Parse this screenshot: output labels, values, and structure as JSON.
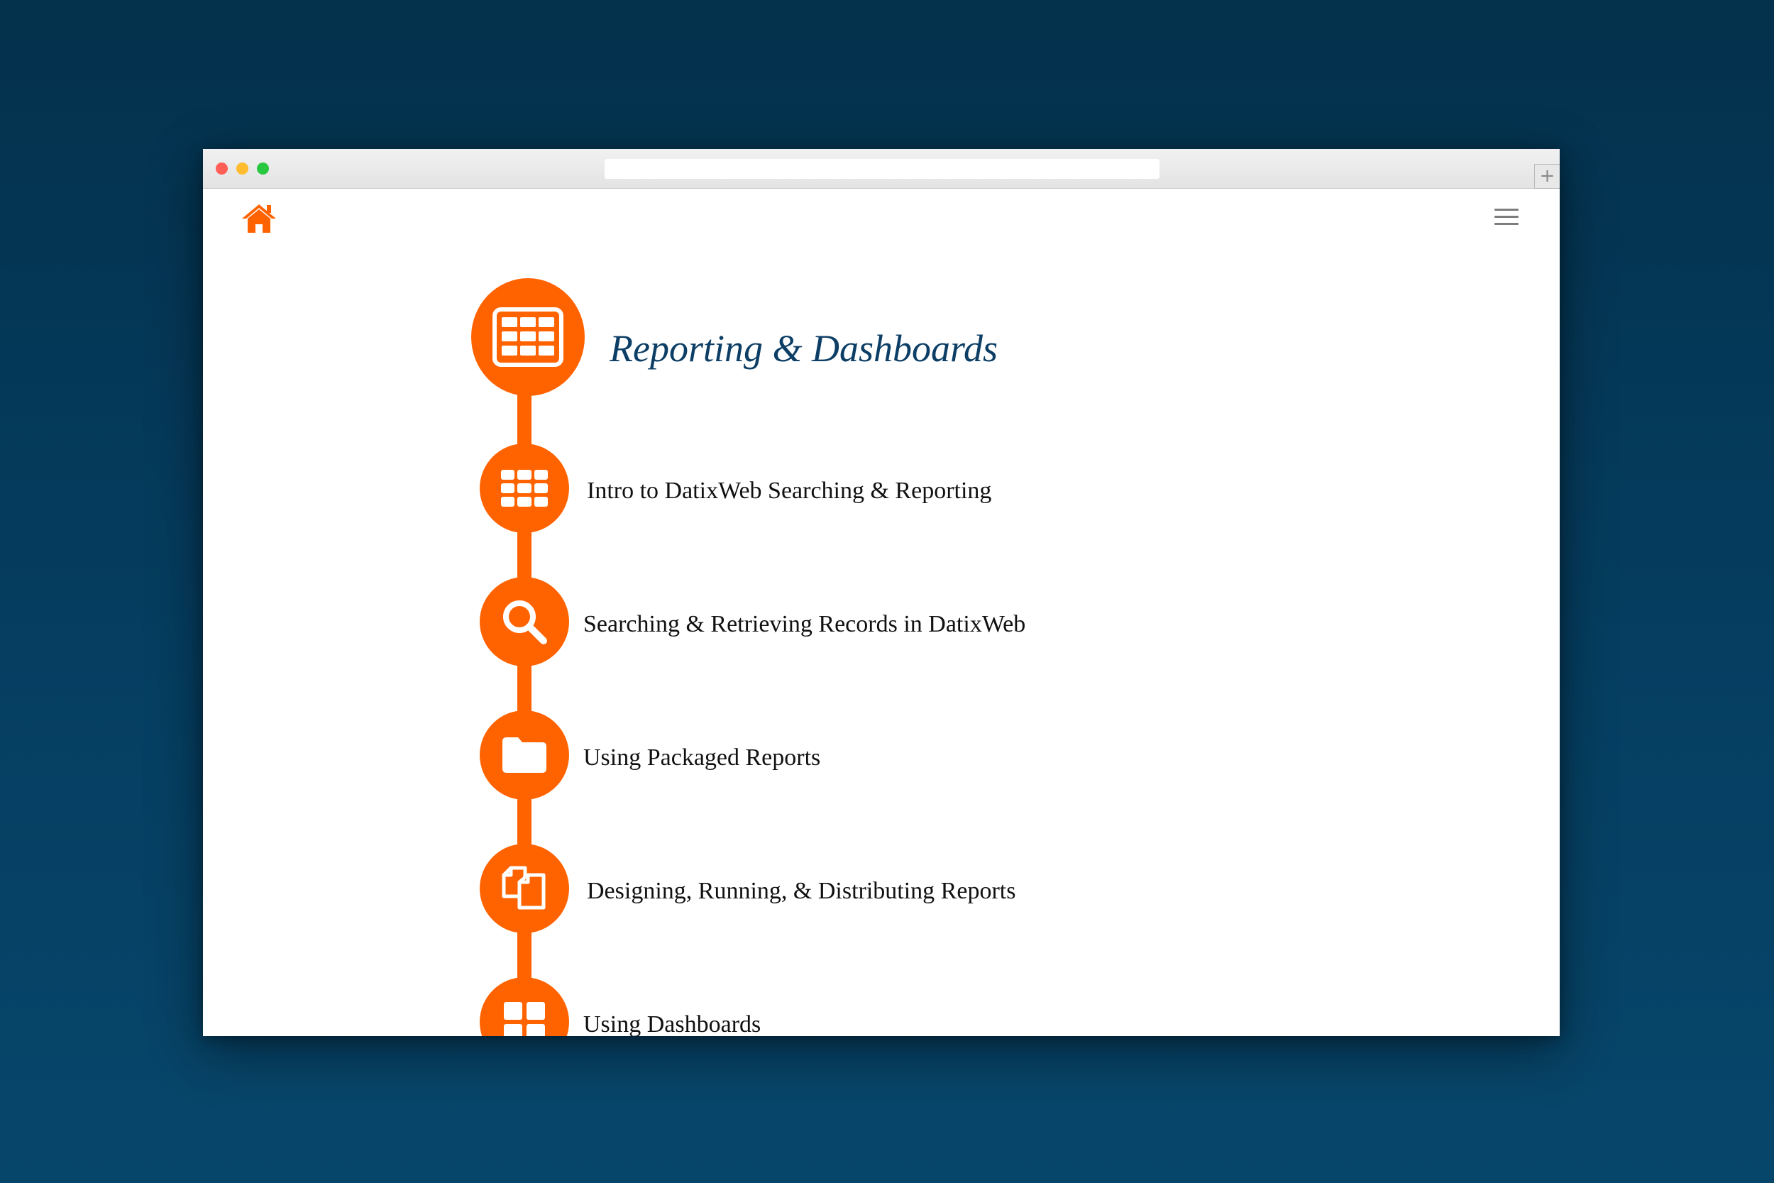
{
  "browser": {
    "newtab_label": "+"
  },
  "page": {
    "section_title": "Reporting & Dashboards",
    "accent_color": "#ff6300",
    "title_color": "#0c3e66",
    "header_icons": [
      "home-icon",
      "hamburger-menu-icon"
    ],
    "items": [
      {
        "label": "Intro to DatixWeb Searching & Reporting",
        "icon": "grid-icon"
      },
      {
        "label": "Searching & Retrieving Records in DatixWeb",
        "icon": "search-icon"
      },
      {
        "label": "Using Packaged Reports",
        "icon": "folder-icon"
      },
      {
        "label": "Designing, Running, & Distributing Reports",
        "icon": "copy-documents-icon"
      },
      {
        "label": "Using Dashboards",
        "icon": "dashboard-icon"
      }
    ]
  }
}
